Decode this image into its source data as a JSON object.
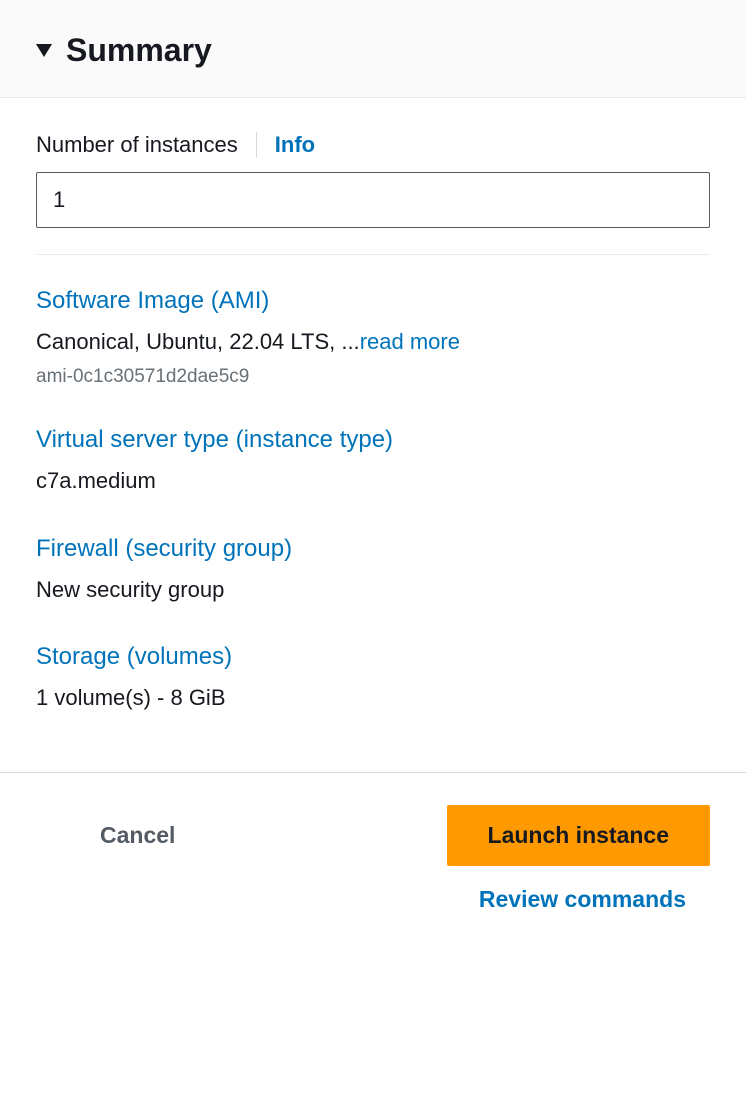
{
  "header": {
    "title": "Summary"
  },
  "instances": {
    "label": "Number of instances",
    "info_label": "Info",
    "value": "1"
  },
  "ami": {
    "title": "Software Image (AMI)",
    "description": "Canonical, Ubuntu, 22.04 LTS, ...",
    "read_more": "read more",
    "id": "ami-0c1c30571d2dae5c9"
  },
  "instance_type": {
    "title": "Virtual server type (instance type)",
    "value": "c7a.medium"
  },
  "firewall": {
    "title": "Firewall (security group)",
    "value": "New security group"
  },
  "storage": {
    "title": "Storage (volumes)",
    "value": "1 volume(s) - 8 GiB"
  },
  "footer": {
    "cancel": "Cancel",
    "launch": "Launch instance",
    "review": "Review commands"
  }
}
